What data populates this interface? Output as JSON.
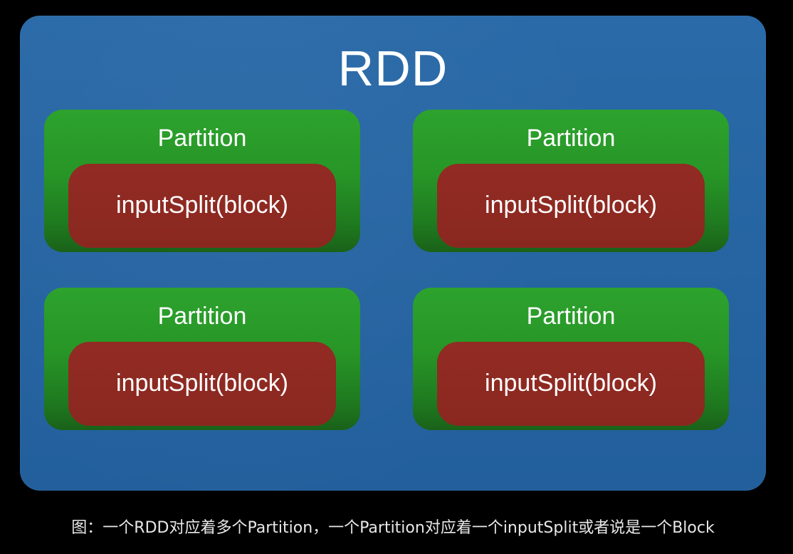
{
  "diagram": {
    "title": "RDD",
    "partitions": [
      {
        "label": "Partition",
        "split_label": "inputSplit(block)"
      },
      {
        "label": "Partition",
        "split_label": "inputSplit(block)"
      },
      {
        "label": "Partition",
        "split_label": "inputSplit(block)"
      },
      {
        "label": "Partition",
        "split_label": "inputSplit(block)"
      }
    ],
    "caption": "图：一个RDD对应着多个Partition，一个Partition对应着一个inputSplit或者说是一个Block"
  },
  "colors": {
    "background": "#000000",
    "rdd_fill": "#225f9c",
    "partition_fill": "#279627",
    "split_fill": "#8e2a22",
    "text": "#ffffff"
  }
}
